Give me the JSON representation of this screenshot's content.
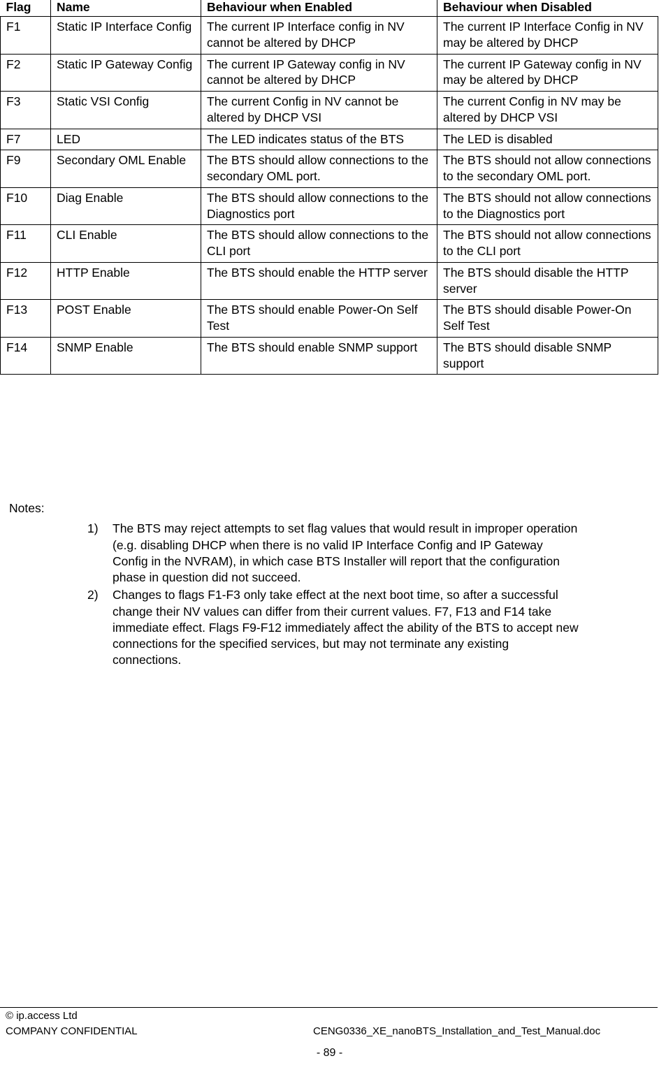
{
  "table": {
    "headers": [
      "Flag",
      "Name",
      "Behaviour when Enabled",
      "Behaviour when Disabled"
    ],
    "rows": [
      {
        "flag": "F1",
        "name": "Static IP Interface Config",
        "enabled": "The current IP Interface config in NV cannot be altered by DHCP",
        "disabled": "The current IP Interface Config in NV may be altered by DHCP"
      },
      {
        "flag": "F2",
        "name": "Static IP Gateway Config",
        "enabled": "The current IP Gateway config in NV cannot be altered by DHCP",
        "disabled": "The current IP Gateway config in NV may be altered by DHCP"
      },
      {
        "flag": "F3",
        "name": "Static VSI Config",
        "enabled": "The current Config in NV cannot be altered by DHCP VSI",
        "disabled": "The current Config in NV may be altered by DHCP VSI"
      },
      {
        "flag": "F7",
        "name": "LED",
        "enabled": "The LED indicates status of the BTS",
        "disabled": "The LED is disabled"
      },
      {
        "flag": "F9",
        "name": "Secondary OML Enable",
        "enabled": "The BTS should allow connections to the secondary OML port.",
        "disabled": "The BTS should not allow connections to the secondary OML port."
      },
      {
        "flag": "F10",
        "name": "Diag Enable",
        "enabled": "The BTS should allow connections to the Diagnostics port",
        "disabled": "The BTS should not allow connections to the Diagnostics port"
      },
      {
        "flag": "F11",
        "name": "CLI Enable",
        "enabled": "The BTS should allow connections to the CLI port",
        "disabled": "The BTS should not allow connections to the CLI port"
      },
      {
        "flag": "F12",
        "name": "HTTP Enable",
        "enabled": "The BTS should enable the HTTP server",
        "disabled": "The BTS should disable the HTTP server"
      },
      {
        "flag": "F13",
        "name": "POST Enable",
        "enabled": "The BTS should enable Power-On Self Test",
        "disabled": "The BTS should disable Power-On Self Test"
      },
      {
        "flag": "F14",
        "name": "SNMP Enable",
        "enabled": "The BTS should enable SNMP support",
        "disabled": "The BTS should disable SNMP support"
      }
    ]
  },
  "notes": {
    "label": "Notes:",
    "items": [
      {
        "marker": "1)",
        "text": "The BTS may reject attempts to set flag values that would result in improper operation (e.g. disabling DHCP when there is no valid IP Interface Config and IP Gateway Config in the NVRAM), in which case BTS Installer will report that the configuration phase in question did not succeed."
      },
      {
        "marker": "2)",
        "text": "Changes to flags F1-F3 only take effect at the next boot time, so after a successful change their NV values can differ from their current values. F7, F13 and F14 take immediate effect. Flags F9-F12 immediately affect the ability of the BTS to accept new connections for the specified services, but may not terminate any existing connections."
      }
    ]
  },
  "footer": {
    "copyright": "© ip.access Ltd",
    "confidentiality": "COMPANY CONFIDENTIAL",
    "document": "CENG0336_XE_nanoBTS_Installation_and_Test_Manual.doc",
    "page_number": "- 89 -"
  }
}
